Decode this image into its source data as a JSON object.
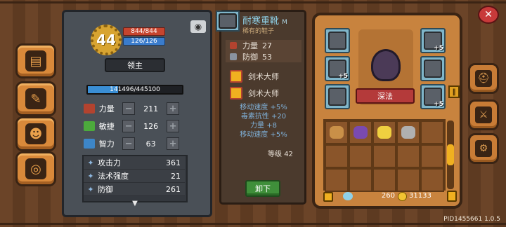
{
  "player": {
    "level": "44",
    "hp": "844/844",
    "mp": "126/126",
    "title": "领主",
    "exp": "141496/445100",
    "exp_fraction": 0.318
  },
  "core_stats": [
    {
      "label": "力量",
      "value": "211",
      "color": "#b3432f"
    },
    {
      "label": "敏捷",
      "value": "126",
      "color": "#4caa3c"
    },
    {
      "label": "智力",
      "value": "63",
      "color": "#3d86c8"
    }
  ],
  "attributes": [
    {
      "label": "攻击力",
      "value": "361"
    },
    {
      "label": "法术强度",
      "value": "21"
    },
    {
      "label": "防御",
      "value": "261"
    }
  ],
  "item": {
    "name": "耐寒重靴",
    "tier": "M",
    "subtitle": "稀有的鞋子",
    "stats": [
      {
        "label": "力量",
        "value": "27"
      },
      {
        "label": "防御",
        "value": "53"
      }
    ],
    "gems": [
      "剑术大师",
      "剑术大师"
    ],
    "bonuses": [
      "移动速度 +5%",
      "毒素抗性 +20",
      "力量 +8",
      "移动速度 +5%"
    ],
    "level_label": "等级",
    "level": "42",
    "unequip_label": "卸下"
  },
  "equipment": {
    "character_name": "深法",
    "slots": [
      {
        "name": "ring-slot",
        "plus": ""
      },
      {
        "name": "necklace-slot",
        "plus": "+5"
      },
      {
        "name": "boots-slot",
        "plus": ""
      },
      {
        "name": "helmet-slot",
        "plus": "+5"
      },
      {
        "name": "armor-slot",
        "plus": ""
      },
      {
        "name": "weapon-slot",
        "plus": "+5"
      }
    ],
    "inventory_icons": [
      "bread-icon",
      "grapes-icon",
      "banana-icon",
      "stone-icon"
    ]
  },
  "currency": {
    "gems": "260",
    "gold": "31133"
  },
  "version": "PID1455661 1.0.5"
}
